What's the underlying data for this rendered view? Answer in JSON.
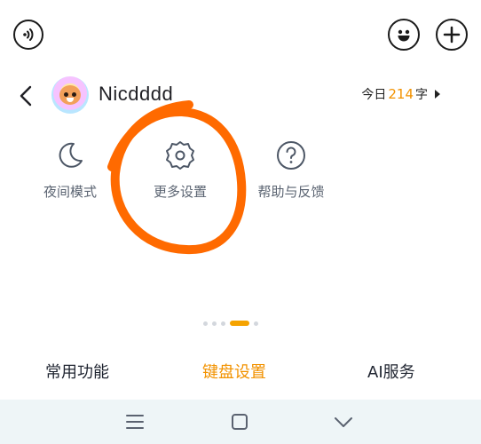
{
  "topbar": {
    "icons": [
      "voice-icon",
      "emoji-icon",
      "add-icon"
    ]
  },
  "header": {
    "username": "Nicdddd",
    "today_prefix": "今日",
    "today_count": "214",
    "today_suffix": "字"
  },
  "menu": {
    "items": [
      {
        "label": "夜间模式",
        "icon": "moon-icon"
      },
      {
        "label": "更多设置",
        "icon": "gear-icon"
      },
      {
        "label": "帮助与反馈",
        "icon": "help-icon"
      }
    ]
  },
  "pager": {
    "count": 5,
    "active": 3
  },
  "tabs": [
    {
      "label": "常用功能"
    },
    {
      "label": "键盘设置",
      "active": true
    },
    {
      "label": "AI服务"
    }
  ],
  "colors": {
    "accent": "#f29200",
    "annotation": "#ff6a00",
    "nav_background": "#eef5f7"
  }
}
